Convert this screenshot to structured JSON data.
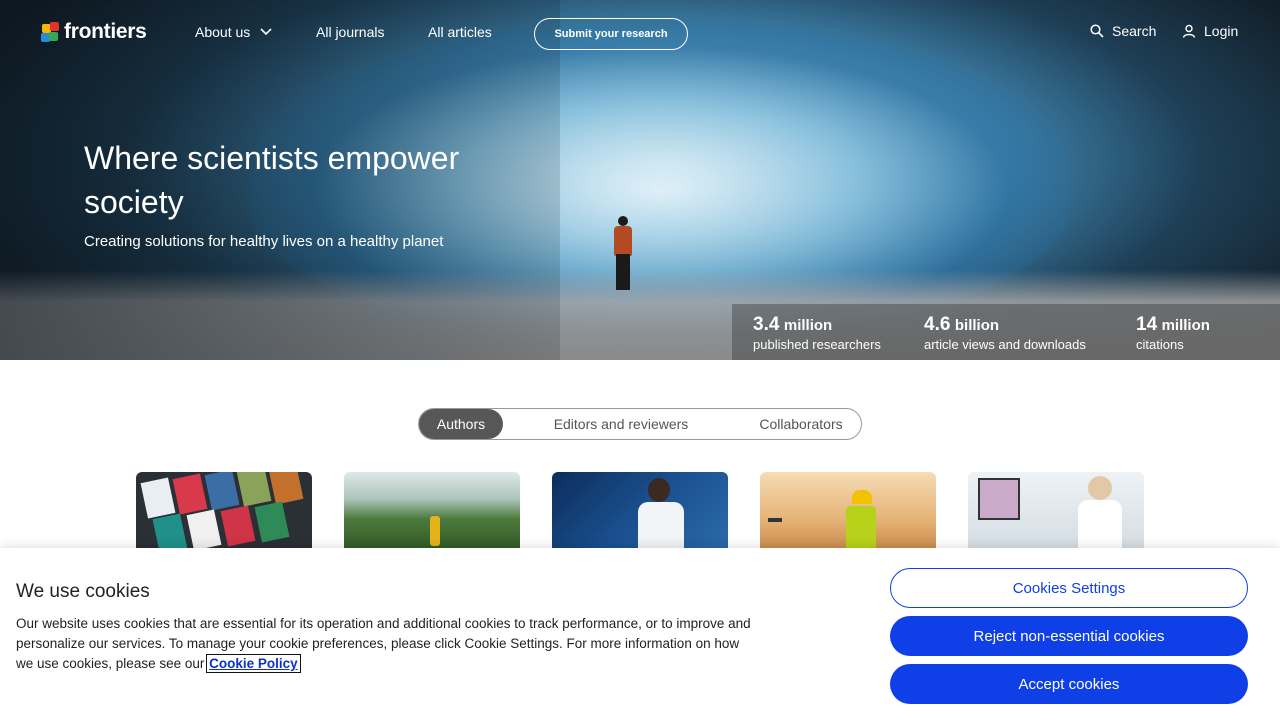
{
  "nav": {
    "logo_text": "frontiers",
    "about_label": "About us",
    "journals_label": "All journals",
    "articles_label": "All articles",
    "submit_label": "Submit your research",
    "search_label": "Search",
    "login_label": "Login"
  },
  "hero": {
    "title": "Where scientists empower society",
    "subtitle": "Creating solutions for healthy lives on a healthy planet"
  },
  "stats": [
    {
      "num": "3.4",
      "unit": "million",
      "desc": "published researchers"
    },
    {
      "num": "4.6",
      "unit": "billion",
      "desc": "article views and downloads"
    },
    {
      "num": "14",
      "unit": "million",
      "desc": "citations"
    }
  ],
  "tabs": [
    {
      "label": "Authors",
      "active": true
    },
    {
      "label": "Editors and reviewers",
      "active": false
    },
    {
      "label": "Collaborators",
      "active": false
    }
  ],
  "cookie": {
    "title": "We use cookies",
    "text": "Our website uses cookies that are essential for its operation and additional cookies to track performance, or to improve and personalize our services. To manage your cookie preferences, please click Cookie Settings. For more information on how we use cookies, please see our ",
    "link_label": "Cookie Policy",
    "settings_label": "Cookies Settings",
    "reject_label": "Reject non-essential cookies",
    "accept_label": "Accept cookies"
  },
  "colors": {
    "accent_blue": "#0f3fe6",
    "tab_active": "#575757"
  }
}
